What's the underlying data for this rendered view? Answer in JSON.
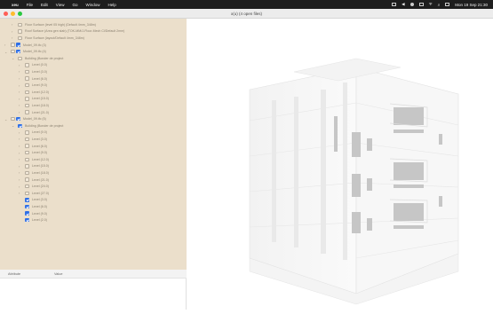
{
  "menubar": {
    "apple": "",
    "app_name": "xeu",
    "items": [
      "File",
      "Edit",
      "View",
      "Go",
      "Window",
      "Help"
    ],
    "clock": "Mon 19 Sep 21:30"
  },
  "window": {
    "title": "x(u) (4 open files)"
  },
  "tree": {
    "rows": [
      {
        "indent": 1,
        "chev": "›",
        "box": "plain",
        "label": "Floor Surface (level 05 high) (Default 4mm_348m)"
      },
      {
        "indent": 1,
        "chev": "›",
        "box": "plain",
        "label": "Roof Surface (Area gen slab) (TOK-MM/J-Floor-Mech Cl/Default 2mm)"
      },
      {
        "indent": 1,
        "chev": "›",
        "box": "plain",
        "label": "Floor Surface (layout/Default 4mm_348m)"
      },
      {
        "indent": 0,
        "chev": "›",
        "box": "both",
        "label": "Model_09.ifc (3)"
      },
      {
        "indent": 0,
        "chev": "⌄",
        "box": "both",
        "label": "Model_09.ifc (4)"
      },
      {
        "indent": 1,
        "chev": "⌄",
        "box": "plain",
        "label": "Building (Bonder de project"
      },
      {
        "indent": 2,
        "chev": "›",
        "box": "plain",
        "label": "Level (0.0)"
      },
      {
        "indent": 2,
        "chev": "›",
        "box": "plain",
        "label": "Level (3.0)"
      },
      {
        "indent": 2,
        "chev": "›",
        "box": "plain",
        "label": "Level (6.0)"
      },
      {
        "indent": 2,
        "chev": "›",
        "box": "plain",
        "label": "Level (9.0)"
      },
      {
        "indent": 2,
        "chev": "›",
        "box": "plain",
        "label": "Level (12.0)"
      },
      {
        "indent": 2,
        "chev": "›",
        "box": "plain",
        "label": "Level (15.0)"
      },
      {
        "indent": 2,
        "chev": "›",
        "box": "plain",
        "label": "Level (18.0)"
      },
      {
        "indent": 2,
        "chev": "›",
        "box": "plain",
        "label": "Level (21.0)"
      },
      {
        "indent": 0,
        "chev": "⌄",
        "box": "both",
        "label": "Model_09.ifc (5)"
      },
      {
        "indent": 1,
        "chev": "⌄",
        "box": "checked",
        "label": "Building (Bonder de project"
      },
      {
        "indent": 2,
        "chev": "›",
        "box": "plain",
        "label": "Level (0.0)"
      },
      {
        "indent": 2,
        "chev": "›",
        "box": "plain",
        "label": "Level (3.0)"
      },
      {
        "indent": 2,
        "chev": "›",
        "box": "plain",
        "label": "Level (6.0)"
      },
      {
        "indent": 2,
        "chev": "›",
        "box": "plain",
        "label": "Level (9.0)"
      },
      {
        "indent": 2,
        "chev": "›",
        "box": "plain",
        "label": "Level (12.0)"
      },
      {
        "indent": 2,
        "chev": "›",
        "box": "plain",
        "label": "Level (15.0)"
      },
      {
        "indent": 2,
        "chev": "›",
        "box": "plain",
        "label": "Level (18.0)"
      },
      {
        "indent": 2,
        "chev": "›",
        "box": "plain",
        "label": "Level (21.0)"
      },
      {
        "indent": 2,
        "chev": "›",
        "box": "plain",
        "label": "Level (24.0)"
      },
      {
        "indent": 2,
        "chev": "›",
        "box": "plain",
        "label": "Level (27.0)"
      },
      {
        "indent": 2,
        "chev": "",
        "box": "checked",
        "label": "Level (3.0)"
      },
      {
        "indent": 2,
        "chev": "",
        "box": "checked",
        "label": "Level (6.0)"
      },
      {
        "indent": 2,
        "chev": "",
        "box": "checked",
        "label": "Level (9.0)"
      },
      {
        "indent": 2,
        "chev": "",
        "box": "checked",
        "label": "Level (2.0)"
      }
    ]
  },
  "attributes": {
    "col1": "Attribute",
    "col2": "Value"
  },
  "colors": {
    "sidebar_bg": "#ebdfcb",
    "checkbox_checked": "#2f6fe6"
  }
}
